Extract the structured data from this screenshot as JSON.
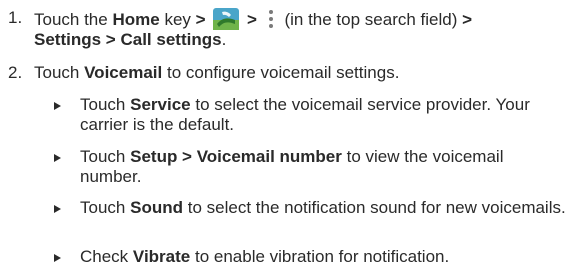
{
  "steps": [
    {
      "number": "1.",
      "touch": "Touch the",
      "home": "Home",
      "key": "key",
      "sep": ">",
      "icon_phone": "phone-app-icon",
      "icon_menu": "more-menu-icon",
      "menu_note": "(in the top search field)",
      "settings": "Settings",
      "call_settings": "Call settings",
      "period": "."
    },
    {
      "number": "2.",
      "touch": "Touch",
      "voicemail": "Voicemail",
      "rest": "to configure voicemail settings."
    }
  ],
  "bullets": [
    {
      "pre": "Touch",
      "bold": "Service",
      "post": "to select the voicemail service provider. Your carrier is the default."
    },
    {
      "pre": "Touch",
      "bold": "Setup > Voicemail number",
      "post": "to view the voicemail number."
    },
    {
      "pre": "Touch",
      "bold": "Sound",
      "post": "to select the notification sound for new voicemails."
    },
    {
      "pre": "Check",
      "bold": "Vibrate",
      "post": "to enable vibration for notification."
    }
  ]
}
